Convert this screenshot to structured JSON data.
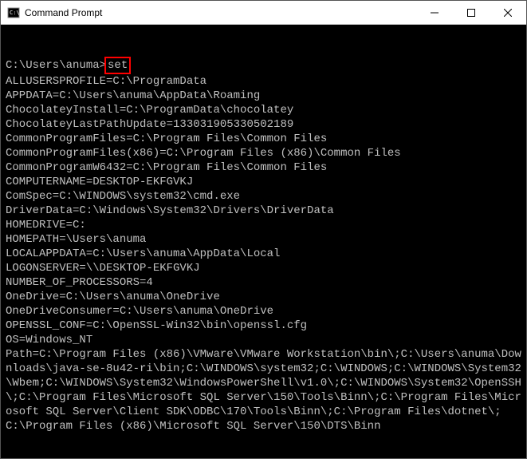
{
  "window": {
    "title": "Command Prompt"
  },
  "terminal": {
    "blank_line": "",
    "prompt": "C:\\Users\\anuma>",
    "command": "set",
    "output_lines": [
      "ALLUSERSPROFILE=C:\\ProgramData",
      "APPDATA=C:\\Users\\anuma\\AppData\\Roaming",
      "ChocolateyInstall=C:\\ProgramData\\chocolatey",
      "ChocolateyLastPathUpdate=133031905330502189",
      "CommonProgramFiles=C:\\Program Files\\Common Files",
      "CommonProgramFiles(x86)=C:\\Program Files (x86)\\Common Files",
      "CommonProgramW6432=C:\\Program Files\\Common Files",
      "COMPUTERNAME=DESKTOP-EKFGVKJ",
      "ComSpec=C:\\WINDOWS\\system32\\cmd.exe",
      "DriverData=C:\\Windows\\System32\\Drivers\\DriverData",
      "HOMEDRIVE=C:",
      "HOMEPATH=\\Users\\anuma",
      "LOCALAPPDATA=C:\\Users\\anuma\\AppData\\Local",
      "LOGONSERVER=\\\\DESKTOP-EKFGVKJ",
      "NUMBER_OF_PROCESSORS=4",
      "OneDrive=C:\\Users\\anuma\\OneDrive",
      "OneDriveConsumer=C:\\Users\\anuma\\OneDrive",
      "OPENSSL_CONF=C:\\OpenSSL-Win32\\bin\\openssl.cfg",
      "OS=Windows_NT",
      "Path=C:\\Program Files (x86)\\VMware\\VMware Workstation\\bin\\;C:\\Users\\anuma\\Downloads\\java-se-8u42-ri\\bin;C:\\WINDOWS\\system32;C:\\WINDOWS;C:\\WINDOWS\\System32\\Wbem;C:\\WINDOWS\\System32\\WindowsPowerShell\\v1.0\\;C:\\WINDOWS\\System32\\OpenSSH\\;C:\\Program Files\\Microsoft SQL Server\\150\\Tools\\Binn\\;C:\\Program Files\\Microsoft SQL Server\\Client SDK\\ODBC\\170\\Tools\\Binn\\;C:\\Program Files\\dotnet\\;C:\\Program Files (x86)\\Microsoft SQL Server\\150\\DTS\\Binn"
    ]
  }
}
